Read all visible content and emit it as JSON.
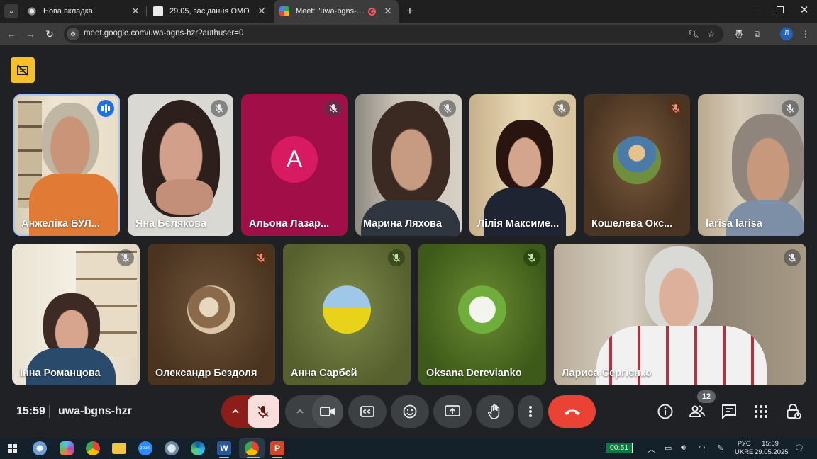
{
  "tabs": [
    {
      "title": "Нова вкладка"
    },
    {
      "title": "29.05, засідання ОМО"
    },
    {
      "title": "Meet: \"uwa-bgns-hzr\""
    }
  ],
  "address": {
    "url": "meet.google.com/uwa-bgns-hzr?authuser=0"
  },
  "profile": {
    "initial": "Л"
  },
  "tiles": [
    {
      "name": "Анжеліка БУЛ..."
    },
    {
      "name": "Яна Бєлякова"
    },
    {
      "name": "Альона Лазар...",
      "letter": "A"
    },
    {
      "name": "Марина Ляхова"
    },
    {
      "name": "Лілія Максиме..."
    },
    {
      "name": "Кошелева Окс..."
    },
    {
      "name": "larisa larisa"
    },
    {
      "name": "Інна Романцова"
    },
    {
      "name": "Олександр Бездоля"
    },
    {
      "name": "Анна Сарбєй"
    },
    {
      "name": "Oksana Derevianko"
    },
    {
      "name": "Лариса Сергієнко"
    }
  ],
  "meeting": {
    "time": "15:59",
    "code": "uwa-bgns-hzr",
    "participants_count": "12"
  },
  "taskbar": {
    "timer": "00:51",
    "lang_line1": "РУС",
    "lang_line2": "UKRE",
    "clock_time": "15:59",
    "clock_date": "29.05.2025"
  },
  "colors": {
    "meet_bg": "#202124",
    "active_border": "#a8c7fa",
    "end_call": "#ea4335",
    "mic_muted_bg": "#f9dedc",
    "badge_yellow": "#f6c026"
  }
}
